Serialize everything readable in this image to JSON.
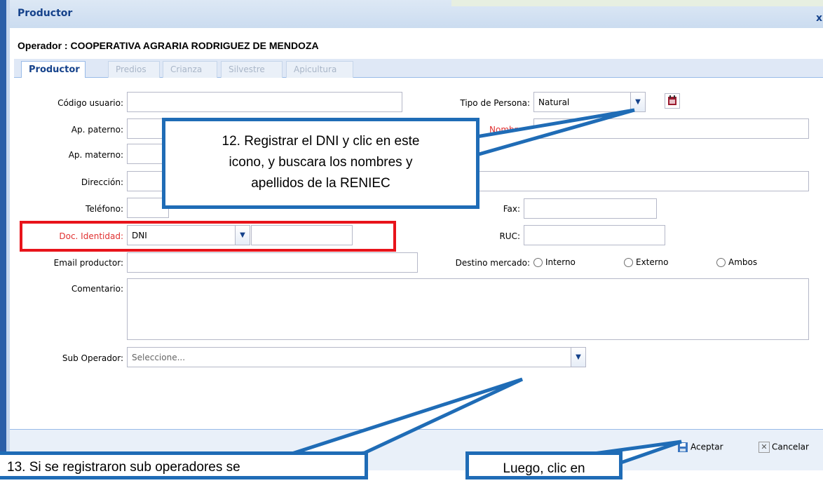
{
  "window": {
    "title": "Productor",
    "close_label": "x"
  },
  "operator": {
    "label": "Operador : COOPERATIVA AGRARIA RODRIGUEZ DE MENDOZA"
  },
  "tabs": [
    {
      "label": "Productor",
      "active": true
    },
    {
      "label": "Predios",
      "active": false
    },
    {
      "label": "Crianza",
      "active": false
    },
    {
      "label": "Silvestre",
      "active": false
    },
    {
      "label": "Apicultura",
      "active": false
    }
  ],
  "form": {
    "codigo_usuario": {
      "label": "Código usuario:",
      "value": ""
    },
    "ap_paterno": {
      "label": "Ap. paterno:",
      "value": ""
    },
    "ap_materno": {
      "label": "Ap. materno:",
      "value": ""
    },
    "direccion": {
      "label": "Dirección:",
      "value": ""
    },
    "telefono": {
      "label": "Teléfono:",
      "value": ""
    },
    "doc_identidad": {
      "label": "Doc. Identidad:",
      "type_value": "DNI",
      "number_value": ""
    },
    "email": {
      "label": "Email productor:",
      "value": ""
    },
    "comentario": {
      "label": "Comentario:",
      "value": ""
    },
    "sub_operador": {
      "label": "Sub Operador:",
      "placeholder": "Seleccione..."
    },
    "tipo_persona": {
      "label": "Tipo de Persona:",
      "value": "Natural"
    },
    "nombres": {
      "label": "Nombres:",
      "value": ""
    },
    "fax": {
      "label": "Fax:",
      "value": ""
    },
    "ruc": {
      "label": "RUC:",
      "value": ""
    },
    "destino_mercado": {
      "label": "Destino mercado:",
      "options": [
        "Interno",
        "Externo",
        "Ambos"
      ]
    }
  },
  "buttons": {
    "aceptar": "Aceptar",
    "cancelar": "Cancelar"
  },
  "callouts": {
    "step12_line1": "12. Registrar el DNI y clic en este",
    "step12_line2": "icono, y buscara los nombres y",
    "step12_line3": "apellidos de la RENIEC",
    "step13": "13. Si se registraron sub operadores se",
    "luego": "Luego, clic en"
  },
  "colors": {
    "accent": "#15428b",
    "callout_border": "#1f6cb6",
    "highlight_red": "#e8141b",
    "required_label": "#e03030"
  }
}
